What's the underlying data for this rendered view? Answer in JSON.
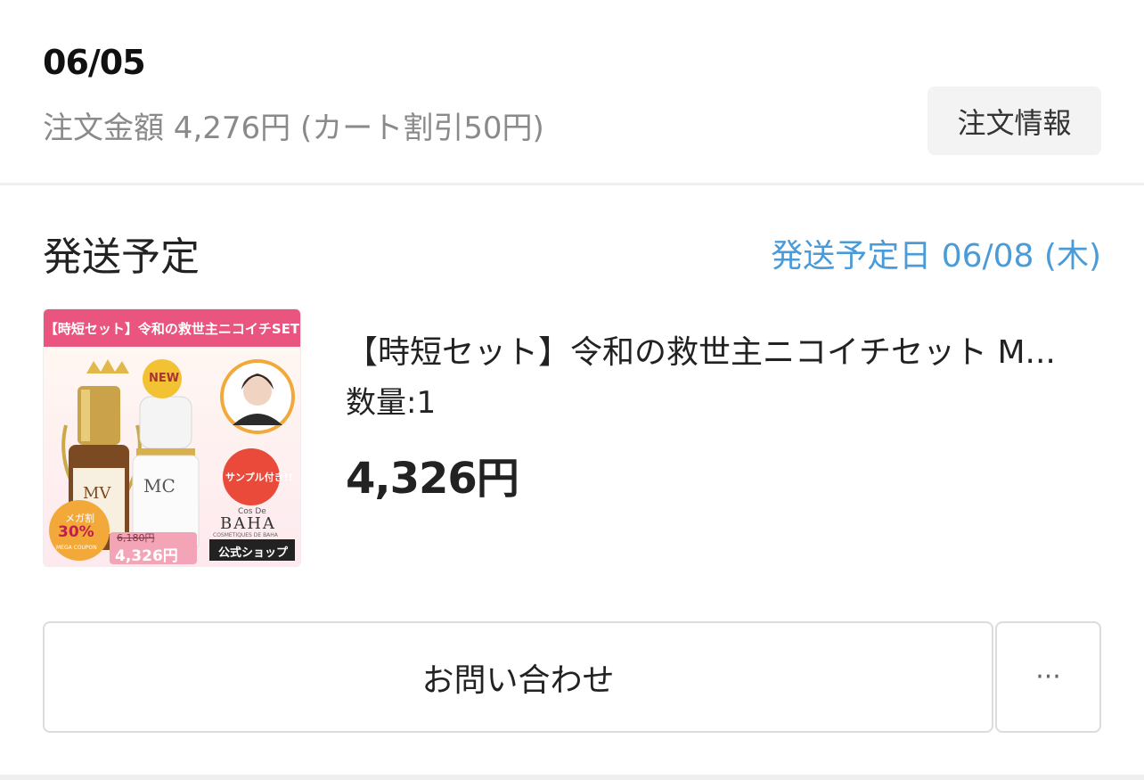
{
  "order": {
    "date": "06/05",
    "amount_text": "注文金額 4,276円 (カート割引50円)",
    "info_button_label": "注文情報"
  },
  "shipping": {
    "title": "発送予定",
    "scheduled_date": "発送予定日 06/08 (木)"
  },
  "product": {
    "title": "【時短セット】令和の救世主ニコイチセット M...",
    "quantity": "数量:1",
    "price": "4,326円",
    "thumbnail": {
      "banner": "【時短セット】令和の救世主ニコイチSET",
      "new_badge": "NEW",
      "sample_badge": "サンプル付き!!",
      "brand_small": "Cos De",
      "brand": "BAHA",
      "brand_sub": "COSMETIQUES DE BAHA",
      "shop_label": "公式ショップ",
      "coupon_label": "メガ割",
      "coupon_percent": "30%",
      "coupon_sub": "MEGA COUPON",
      "old_price": "6,180円",
      "sale_price": "4,326円",
      "bottle_left_label": "MV",
      "bottle_right_label": "MC"
    }
  },
  "actions": {
    "inquiry_label": "お問い合わせ",
    "more_label": "···"
  },
  "colors": {
    "accent_blue": "#4a9bd8",
    "banner_pink": "#e9557f",
    "muted_gray": "#8a8a8a"
  }
}
